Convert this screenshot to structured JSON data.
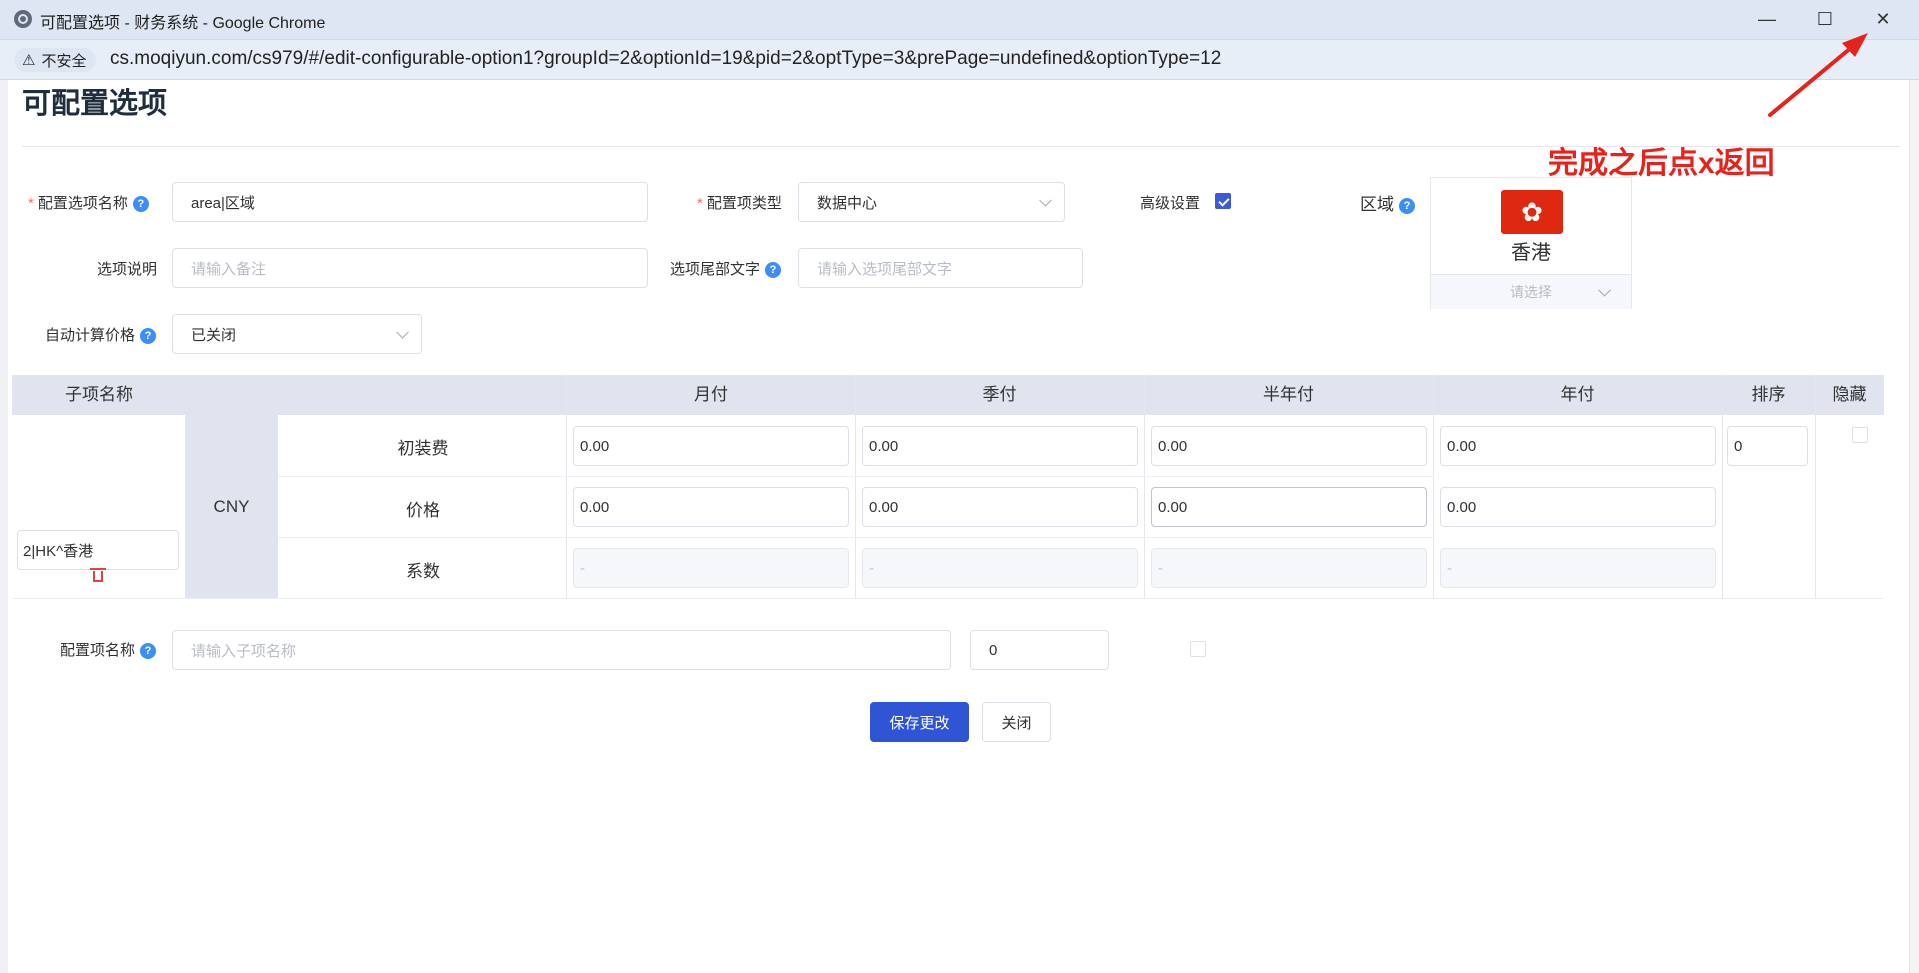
{
  "window": {
    "title": "可配置选项 - 财务系统 - Google Chrome",
    "minimize": "—",
    "maximize": "☐",
    "close": "✕"
  },
  "address_bar": {
    "security_label": "不安全",
    "url": "cs.moqiyun.com/cs979/#/edit-configurable-option1?groupId=2&optionId=19&pid=2&optType=3&prePage=undefined&optionType=12"
  },
  "annotation": "完成之后点x返回",
  "page": {
    "title": "可配置选项"
  },
  "form": {
    "option_name": {
      "label": "配置选项名称",
      "required": "*",
      "value": "area|区域"
    },
    "option_type": {
      "label": "配置项类型",
      "required": "*",
      "value": "数据中心"
    },
    "advanced": {
      "label": "高级设置",
      "checked": true
    },
    "region": {
      "label": "区域",
      "selected": "香港",
      "placeholder": "请选择"
    },
    "description": {
      "label": "选项说明",
      "placeholder": "请输入备注"
    },
    "suffix": {
      "label": "选项尾部文字",
      "placeholder": "请输入选项尾部文字"
    },
    "auto_price": {
      "label": "自动计算价格",
      "value": "已关闭"
    }
  },
  "table": {
    "headers": [
      "子项名称",
      "月付",
      "季付",
      "半年付",
      "年付",
      "排序",
      "隐藏"
    ],
    "currency": "CNY",
    "sub_item_name": "2|HK^香港",
    "row_labels": [
      "初装费",
      "价格",
      "系数"
    ],
    "setup_fee": [
      "0.00",
      "0.00",
      "0.00",
      "0.00"
    ],
    "price": [
      "0.00",
      "0.00",
      "0.00",
      "0.00"
    ],
    "factor": [
      "-",
      "-",
      "-",
      "-"
    ],
    "sort": "0",
    "hidden": false
  },
  "new_item": {
    "label": "配置项名称",
    "placeholder": "请输入子项名称",
    "sort": "0",
    "hidden": false
  },
  "buttons": {
    "save": "保存更改",
    "close": "关闭"
  },
  "colors": {
    "primary": "#2f55d4",
    "annotation": "#e8221b",
    "header_bg": "#dfe4ee"
  }
}
